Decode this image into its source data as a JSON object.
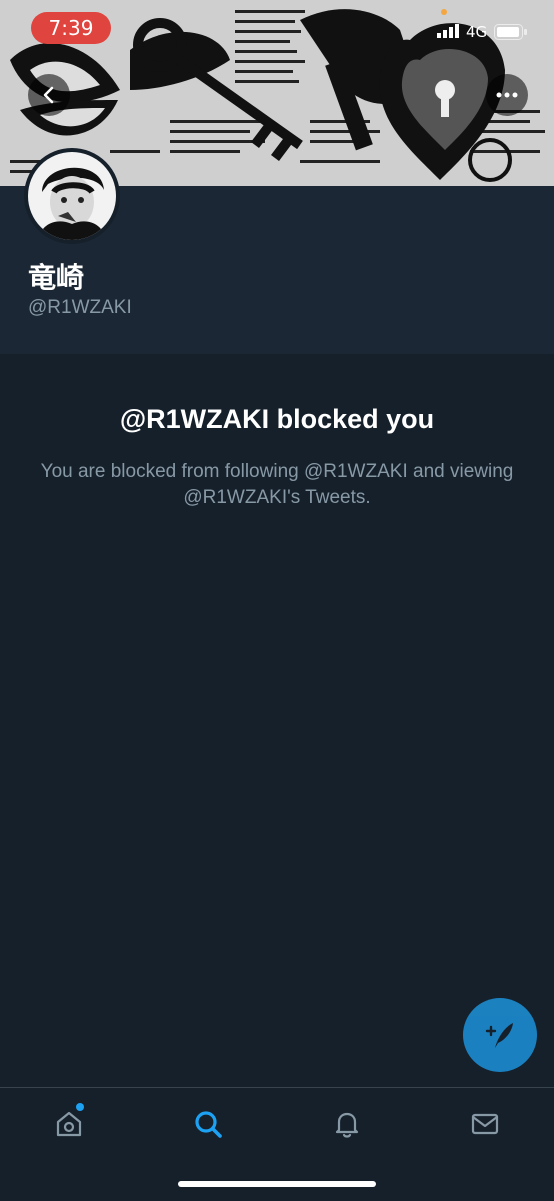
{
  "status_bar": {
    "time": "7:39",
    "network": "4G"
  },
  "icons": {
    "back": "chevron-left-icon",
    "more": "more-dots-icon",
    "compose": "compose-tweet-icon",
    "home": "home-icon",
    "search": "search-icon",
    "notifications": "bell-icon",
    "messages": "mail-icon"
  },
  "profile": {
    "display_name": "竜崎",
    "handle": "@R1WZAKI"
  },
  "blocked": {
    "title": "@R1WZAKI blocked you",
    "description": "You are blocked from following @R1WZAKI and viewing @R1WZAKI's Tweets."
  },
  "colors": {
    "background": "#15202b",
    "header": "#1b2734",
    "accent": "#1da1f2",
    "secondary_text": "#8899a6",
    "time_pill": "#e0443e"
  },
  "tabbar": {
    "active": "search"
  }
}
